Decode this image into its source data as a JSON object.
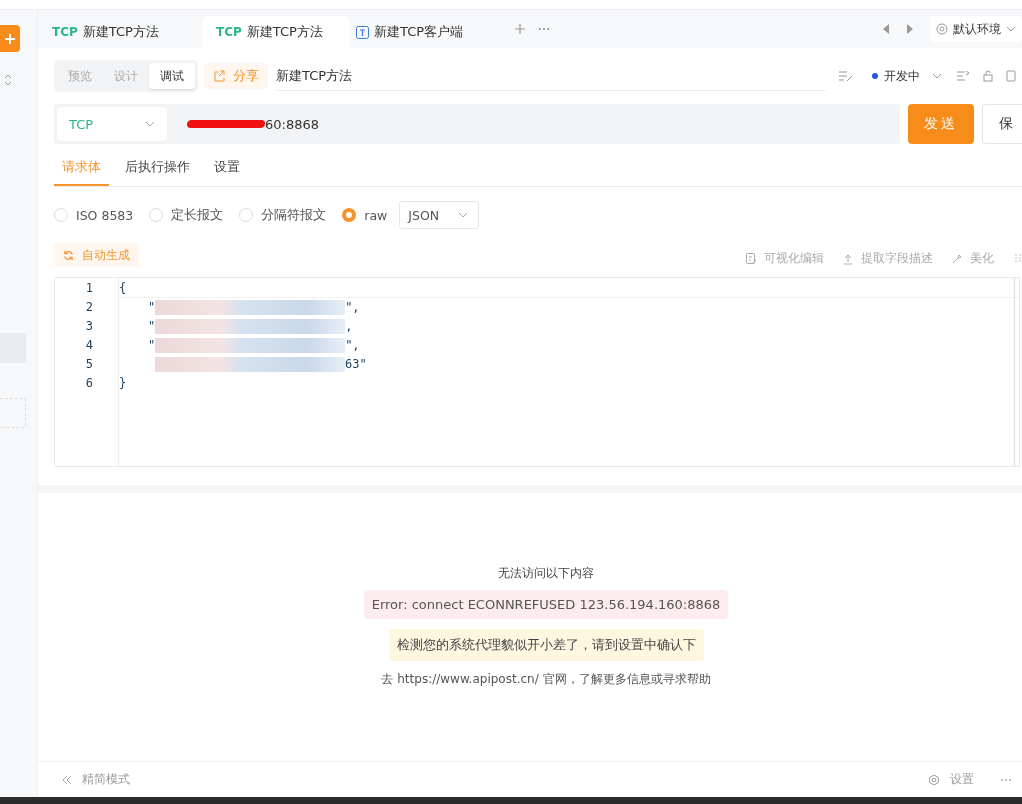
{
  "tabs": [
    {
      "kind": "tcp",
      "badge": "TCP",
      "label": "新建TCP方法",
      "selected": false
    },
    {
      "kind": "tcp",
      "badge": "TCP",
      "label": "新建TCP方法",
      "selected": true
    },
    {
      "kind": "client",
      "label": "新建TCP客户端",
      "selected": false
    }
  ],
  "environment": "默认环境",
  "mode_switch": [
    {
      "label": "预览",
      "selected": false
    },
    {
      "label": "设计",
      "selected": false
    },
    {
      "label": "调试",
      "selected": true
    }
  ],
  "share_button": "分享",
  "api_name": "新建TCP方法",
  "status": {
    "label": "开发中",
    "color": "#2356e8"
  },
  "protocol": "TCP",
  "url": {
    "value": "60:8868",
    "redacted": true
  },
  "send_button": "发送",
  "save_button": "保",
  "body_tabs": [
    {
      "label": "请求体",
      "selected": true
    },
    {
      "label": "后执行操作",
      "selected": false
    },
    {
      "label": "设置",
      "selected": false
    }
  ],
  "formats": [
    {
      "label": "ISO 8583",
      "selected": false
    },
    {
      "label": "定长报文",
      "selected": false
    },
    {
      "label": "分隔符报文",
      "selected": false
    },
    {
      "label": "raw",
      "selected": true
    }
  ],
  "format_select": "JSON",
  "auto_generate": "自动生成",
  "tools": [
    {
      "kind": "visual",
      "label": "可视化编辑"
    },
    {
      "kind": "extract",
      "label": "提取字段描述"
    },
    {
      "kind": "beautify",
      "label": "美化"
    }
  ],
  "editor_lines": [
    {
      "number": "1",
      "prefix": "{",
      "redacted": false
    },
    {
      "number": "2",
      "prefix": "    \"",
      "redacted": true,
      "suffix": "\","
    },
    {
      "number": "3",
      "prefix": "    \"",
      "redacted": true,
      "suffix": ","
    },
    {
      "number": "4",
      "prefix": "    \"",
      "redacted": true,
      "suffix": "\","
    },
    {
      "number": "5",
      "redacted": true,
      "suffix": "63\""
    },
    {
      "number": "6",
      "prefix": "}",
      "redacted": false
    }
  ],
  "response": {
    "heading": "无法访问以下内容",
    "error": "Error: connect ECONNREFUSED 123.56.194.160:8868",
    "warning": "检测您的系统代理貌似开小差了，请到设置中确认下",
    "help": "去 https://www.apipost.cn/ 官网，了解更多信息或寻求帮助"
  },
  "footer": {
    "simple_mode": "精简模式",
    "settings": "设置"
  }
}
